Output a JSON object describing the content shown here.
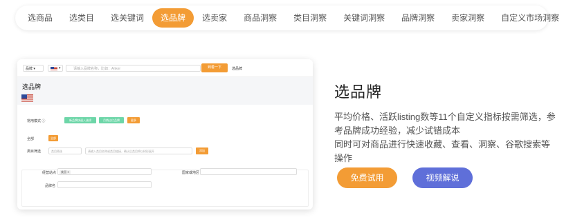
{
  "nav": {
    "items": [
      "选商品",
      "选类目",
      "选关键词",
      "选品牌",
      "选卖家",
      "商品洞察",
      "类目洞察",
      "关键词洞察",
      "品牌洞察",
      "卖家洞察",
      "自定义市场洞察"
    ],
    "active_index": 3
  },
  "screenshot": {
    "brand_select": "品牌",
    "search_placeholder": "请输入品牌名称，比如：Anker",
    "search_button": "到着一下",
    "top_label": "选品牌",
    "title": "选品牌",
    "row_quick": "常用模式 ⓘ",
    "tag_1": "新品牌快速入选榜",
    "tag_2": "月销过亿品牌",
    "tag_3": "更多",
    "row_all": "全部",
    "tag_all": "全部",
    "row_category": "类目筛选",
    "category_select": "类目筛选",
    "category_input_placeholder": "请输入类目名称或类目链接，确认后类目将以树形展开",
    "category_button": "添加",
    "field_price_label": "经营站点",
    "field_price_chip": "美国 ✕",
    "field_country_label": "国家或地区",
    "field_brand_label": "品牌名"
  },
  "heading": "选品牌",
  "desc_lines": [
    "平均价格、活跃listing数等11个自定义指标按需筛选，参",
    "考品牌成功经验，减少试错成本",
    "同时可对商品进行快速收藏、查看、洞察、谷歌搜索等操作"
  ],
  "buttons": {
    "trial": "免费试用",
    "video": "视频解说"
  },
  "colors": {
    "accent": "#f39c35",
    "secondary": "#5f6fd9"
  }
}
